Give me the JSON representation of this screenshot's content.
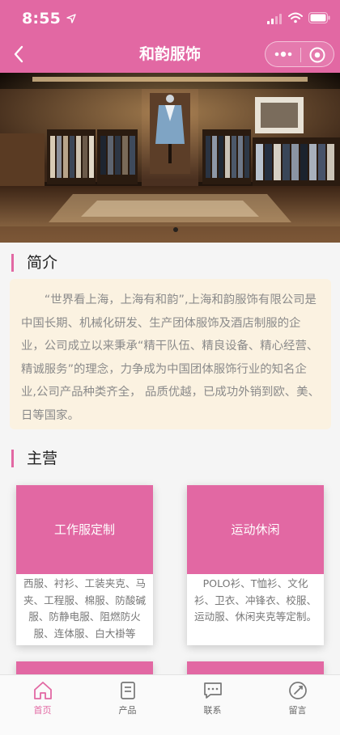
{
  "status_bar": {
    "time": "8:55"
  },
  "navbar": {
    "title": "和韵服饰"
  },
  "intro": {
    "section_title": "简介",
    "text": "“世界看上海，上海有和韵”,上海和韵服饰有限公司是中国长期、机械化研发、生产团体服饰及酒店制服的企业，公司成立以来秉承“精干队伍、精良设备、精心经营、精诚服务”的理念，力争成为中国团体服饰行业的知名企业,公司产品种类齐全， 品质优越，已成功外销到欧、美、日等国家。"
  },
  "business": {
    "section_title": "主营",
    "cards": [
      {
        "title": "工作服定制",
        "desc": "西服、衬衫、工装夹克、马夹、工程服、棉服、防酸碱服、防静电服、阻燃防火服、连体服、白大褂等"
      },
      {
        "title": "运动休闲",
        "desc": "POLO衫、T恤衫、文化衫、卫衣、冲锋衣、校服、运动服、休闲夹克等定制。"
      }
    ]
  },
  "tabbar": {
    "items": [
      {
        "label": "首页",
        "icon": "home-icon"
      },
      {
        "label": "产品",
        "icon": "product-icon"
      },
      {
        "label": "联系",
        "icon": "contact-icon"
      },
      {
        "label": "留言",
        "icon": "message-icon"
      }
    ]
  },
  "colors": {
    "brand": "#e268a3",
    "intro_bg": "#fbf2e1"
  }
}
